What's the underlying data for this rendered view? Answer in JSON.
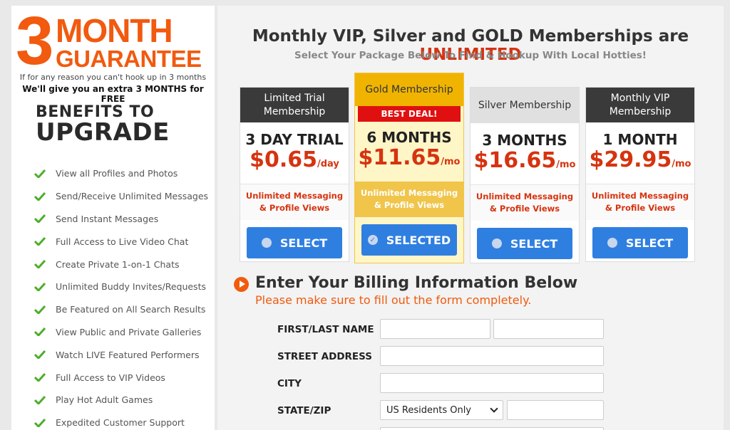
{
  "sidebar": {
    "guarantee": {
      "number": "3",
      "word1": "MONTH",
      "word2": "GUARANTEE",
      "line1": "If for any reason you can't hook up in 3 months",
      "line2": "We'll give you an extra 3 MONTHS for FREE"
    },
    "benefits_title_line1": "BENEFITS TO",
    "benefits_title_line2": "UPGRADE",
    "benefits": [
      "View all Profiles and Photos",
      "Send/Receive Unlimited Messages",
      "Send Instant Messages",
      "Full Access to Live Video Chat",
      "Create Private 1-on-1 Chats",
      "Unlimited Buddy Invites/Requests",
      "Be Featured on All Search Results",
      "View Public and Private Galleries",
      "Watch LIVE Featured Performers",
      "Full Access to VIP Videos",
      "Play Hot Adult Games",
      "Expedited Customer Support"
    ],
    "check_icon": "check-icon",
    "check_color": "#4caf28"
  },
  "header": {
    "headline_prefix": "Monthly VIP, Silver and GOLD Memberships are ",
    "headline_accent": "UNLIMITED",
    "subhead": "Select Your Package Below To Find & Hookup With Local Hotties!"
  },
  "plans": [
    {
      "name": "Limited Trial Membership",
      "term": "3 DAY TRIAL",
      "price": "$0.65",
      "unit": "/day",
      "feature_line1": "Unlimited Messaging",
      "feature_line2": "& Profile Views",
      "button": "SELECT",
      "selected": false
    },
    {
      "name": "Gold Membership",
      "badge": "BEST DEAL!",
      "term": "6 MONTHS",
      "price": "$11.65",
      "unit": "/mo",
      "feature_line1": "Unlimited Messaging",
      "feature_line2": "& Profile Views",
      "button": "SELECTED",
      "selected": true
    },
    {
      "name": "Silver Membership",
      "term": "3 MONTHS",
      "price": "$16.65",
      "unit": "/mo",
      "feature_line1": "Unlimited Messaging",
      "feature_line2": "& Profile Views",
      "button": "SELECT",
      "selected": false
    },
    {
      "name": "Monthly VIP Membership",
      "term": "1 MONTH",
      "price": "$29.95",
      "unit": "/mo",
      "feature_line1": "Unlimited Messaging",
      "feature_line2": "& Profile Views",
      "button": "SELECT",
      "selected": false
    }
  ],
  "billing": {
    "title": "Enter Your Billing Information Below",
    "subtitle": "Please make sure to fill out the form completely.",
    "labels": {
      "name": "FIRST/LAST NAME",
      "street": "STREET ADDRESS",
      "city": "CITY",
      "state_zip": "STATE/ZIP"
    },
    "state_selected": "US Residents Only"
  },
  "colors": {
    "accent_orange": "#f15a0f",
    "accent_red": "#d6330f",
    "button_blue": "#2f7fe0",
    "gold": "#f0b400"
  }
}
